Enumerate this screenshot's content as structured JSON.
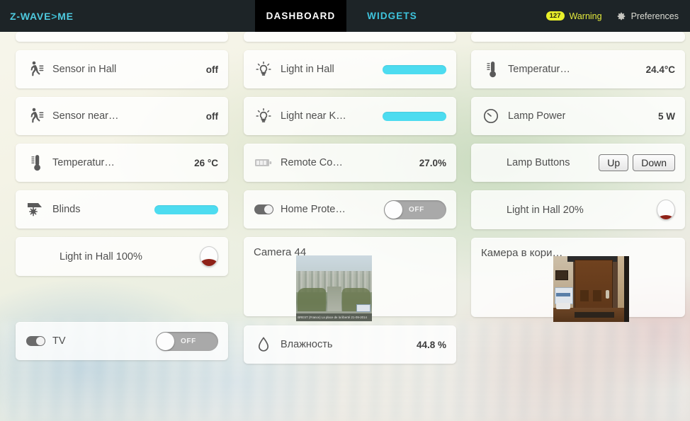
{
  "header": {
    "logo": "Z-WAVE",
    "logo_chevron": ">",
    "logo_suffix": "ME",
    "tabs": [
      {
        "label": "DASHBOARD",
        "active": true
      },
      {
        "label": "WIDGETS",
        "active": false
      }
    ],
    "warning": {
      "count": "127",
      "label": "Warning",
      "badge_color": "#e8ef2a"
    },
    "preferences": {
      "label": "Preferences",
      "icon": "gear-icon"
    }
  },
  "colors": {
    "topbar": "#1d2427",
    "accent_cyan": "#4ddcf0",
    "logo_cyan": "#4ec9de",
    "tab_inactive": "#3ec4dd",
    "dial_red": "#8f2218",
    "toggle_off_track": "#a9a9a9"
  },
  "columns": [
    {
      "name": "column-1",
      "widgets": [
        {
          "type": "stub"
        },
        {
          "type": "sensor",
          "icon": "motion-sensor-icon",
          "title": "Sensor in Hall",
          "value": "off"
        },
        {
          "type": "sensor",
          "icon": "motion-sensor-icon",
          "title": "Sensor near…",
          "value": "off"
        },
        {
          "type": "sensor",
          "icon": "thermometer-icon",
          "title": "Temperatur…",
          "value": "26 °C"
        },
        {
          "type": "slider",
          "icon": "blinds-icon",
          "title": "Blinds"
        },
        {
          "type": "dial",
          "title": "Light in Hall 100%"
        },
        {
          "type": "toggle",
          "icon": "toggle-icon",
          "title": "TV",
          "state": "OFF"
        }
      ]
    },
    {
      "name": "column-2",
      "widgets": [
        {
          "type": "stub"
        },
        {
          "type": "slider",
          "icon": "lightbulb-icon",
          "title": "Light in Hall"
        },
        {
          "type": "slider",
          "icon": "lightbulb-icon",
          "title": "Light near K…"
        },
        {
          "type": "sensor",
          "icon": "battery-icon",
          "title": "Remote Co…",
          "value": "27.0%"
        },
        {
          "type": "toggle",
          "icon": "toggle-icon",
          "title": "Home Prote…",
          "state": "OFF"
        },
        {
          "type": "camera",
          "title": "Camera 44",
          "caption": "BREST (France) La place de la liberté   21-09-2014"
        },
        {
          "type": "sensor",
          "icon": "humidity-drop-icon",
          "title": "Влажность",
          "value": "44.8 %"
        }
      ]
    },
    {
      "name": "column-3",
      "widgets": [
        {
          "type": "stub"
        },
        {
          "type": "sensor",
          "icon": "thermometer-icon",
          "title": "Temperatur…",
          "value": "24.4°C"
        },
        {
          "type": "sensor",
          "icon": "power-meter-icon",
          "title": "Lamp Power",
          "value": "5 W"
        },
        {
          "type": "buttons",
          "title": "Lamp Buttons",
          "buttons": [
            "Up",
            "Down"
          ]
        },
        {
          "type": "dial",
          "title": "Light in Hall 20%"
        },
        {
          "type": "camera",
          "title": "Камера в кори…",
          "caption": ""
        }
      ]
    }
  ]
}
